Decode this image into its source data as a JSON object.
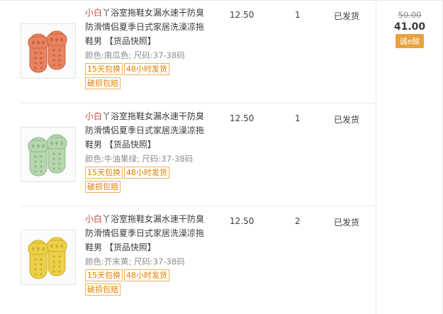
{
  "items": [
    {
      "shop": "小白",
      "title_rest": "丫浴室拖鞋女漏水速干防臭防滑情侣夏季日式家居洗澡凉拖鞋男 【货品快照】",
      "spec": "颜色:南瓜色;  尺码:37-38码",
      "tags": [
        "15天包换",
        "48小时发货",
        "破损包赔"
      ],
      "price": "12.50",
      "qty": "1",
      "status": "已发货",
      "color": "#e8825f",
      "color_dark": "#c9623f",
      "icon": "slipper-pair-image"
    },
    {
      "shop": "小白",
      "title_rest": "丫浴室拖鞋女漏水速干防臭防滑情侣夏季日式家居洗澡凉拖鞋男 【货品快照】",
      "spec": "颜色:牛油果绿;  尺码:37-38码",
      "tags": [
        "15天包换",
        "48小时发货",
        "破损包赔"
      ],
      "price": "12.50",
      "qty": "1",
      "status": "已发货",
      "color": "#b6d6b0",
      "color_dark": "#8fb889",
      "icon": "slipper-pair-image"
    },
    {
      "shop": "小白",
      "title_rest": "丫浴室拖鞋女漏水速干防臭防滑情侣夏季日式家居洗澡凉拖鞋男 【货品快照】",
      "spec": "颜色:芥末黄;  尺码:37-38码",
      "tags": [
        "15天包换",
        "48小时发货",
        "破损包赔"
      ],
      "price": "12.50",
      "qty": "2",
      "status": "已发货",
      "color": "#ecd04a",
      "color_dark": "#cdb02a",
      "icon": "slipper-pair-image"
    }
  ],
  "order": {
    "original_price": "50.00",
    "paid_price": "41.00",
    "pay_button": "诚e赊"
  },
  "colors": {
    "accent_orange": "#e27e00",
    "tag_border": "#e8b35b",
    "button_bg": "#e8a23e",
    "shop_red": "#d9393b"
  }
}
